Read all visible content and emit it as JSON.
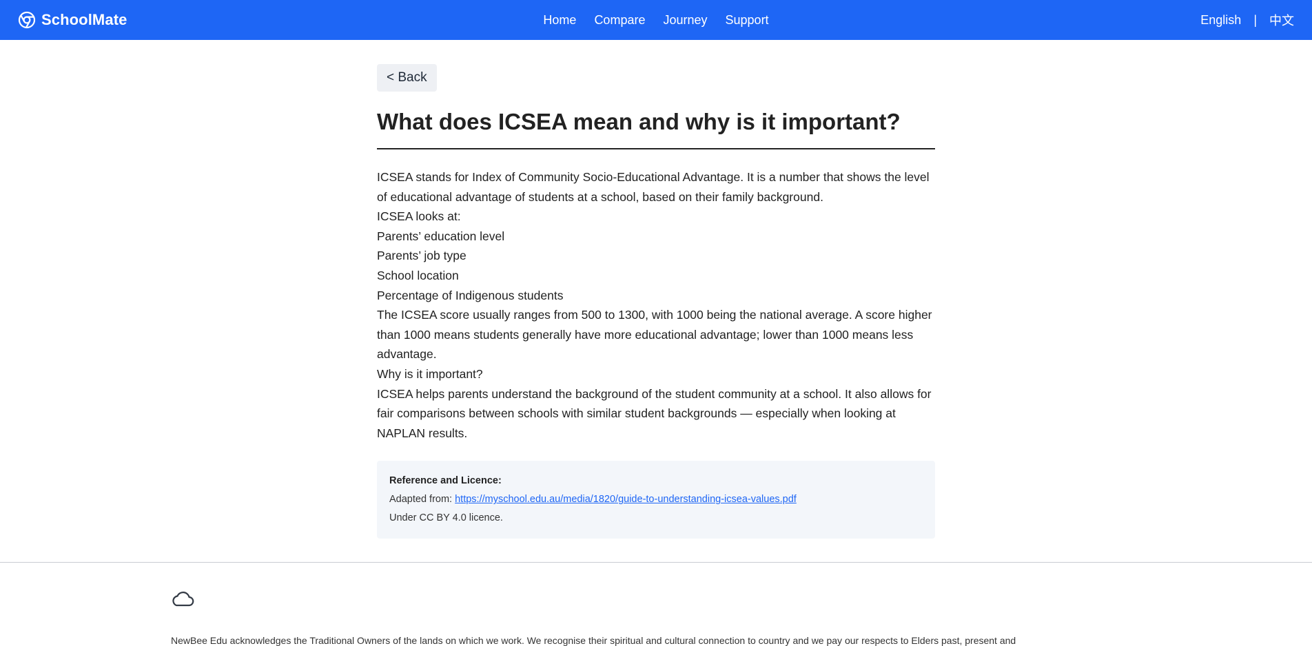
{
  "header": {
    "brand": "SchoolMate",
    "nav": [
      "Home",
      "Compare",
      "Journey",
      "Support"
    ],
    "lang_en": "English",
    "lang_sep": "|",
    "lang_zh": "中文",
    "bg_color": "#1e66f5"
  },
  "main": {
    "back_label": "< Back",
    "title": "What does ICSEA mean and why is it important?",
    "paragraphs": [
      "ICSEA stands for Index of Community Socio-Educational Advantage. It is a number that shows the level of educational advantage of students at a school, based on their family background.",
      "ICSEA looks at:",
      "Parents’ education level",
      "Parents’ job type",
      "School location",
      "Percentage of Indigenous students",
      "The ICSEA score usually ranges from 500 to 1300, with 1000 being the national average. A score higher than 1000 means students generally have more educational advantage; lower than 1000 means less advantage.",
      "Why is it important?",
      "ICSEA helps parents understand the background of the student community at a school. It also allows for fair comparisons between schools with similar student backgrounds — especially when looking at NAPLAN results."
    ]
  },
  "reference": {
    "title": "Reference and Licence:",
    "adapted_prefix": "Adapted from: ",
    "link_text": "https://myschool.edu.au/media/1820/guide-to-understanding-icsea-values.pdf",
    "licence": "Under CC BY 4.0 licence."
  },
  "footer": {
    "icon": "cloud-icon",
    "acknowledgement": "NewBee Edu acknowledges the Traditional Owners of the lands on which we work. We recognise their spiritual and cultural connection to country and we pay our respects to Elders past, present and"
  }
}
